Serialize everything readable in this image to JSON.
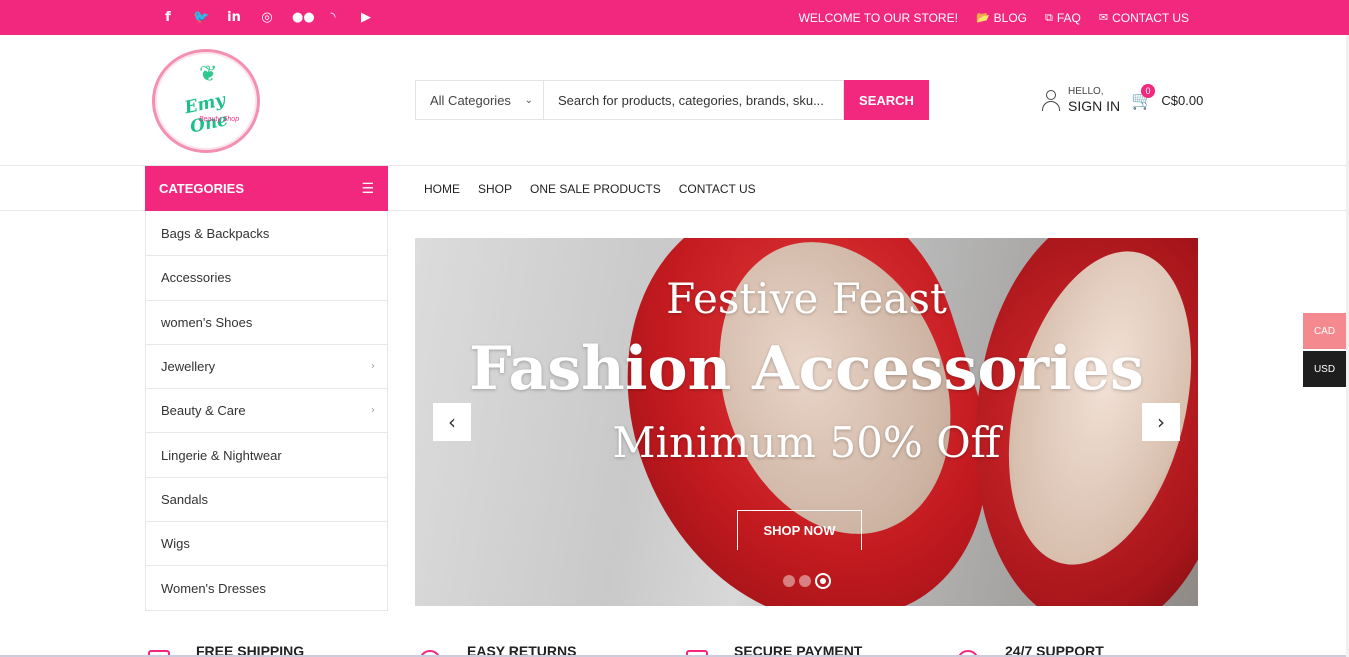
{
  "topbar": {
    "social_icons": [
      {
        "name": "facebook-icon",
        "glyph": "f"
      },
      {
        "name": "twitter-icon",
        "glyph": "🐦"
      },
      {
        "name": "linkedin-icon",
        "glyph": "in"
      },
      {
        "name": "instagram-icon",
        "glyph": "◎"
      },
      {
        "name": "flickr-icon",
        "glyph": "●●"
      },
      {
        "name": "rss-icon",
        "glyph": "◝"
      },
      {
        "name": "youtube-icon",
        "glyph": "▶"
      }
    ],
    "welcome": "WELCOME TO OUR STORE!",
    "blog": "BLOG",
    "faq": "FAQ",
    "contact": "CONTACT US",
    "blog_icon": "📂",
    "faq_icon": "⧉",
    "contact_icon": "✉"
  },
  "logo": {
    "brand": "Emy One",
    "sub": "Beauty Shop"
  },
  "search": {
    "category": "All Categories",
    "placeholder": "Search for products, categories, brands, sku...",
    "button": "SEARCH"
  },
  "account": {
    "hello": "HELLO,",
    "signin": "SIGN IN"
  },
  "cart": {
    "count": "0",
    "amount": "C$0.00"
  },
  "categories_header": "CATEGORIES",
  "mainnav": [
    "HOME",
    "SHOP",
    "ONE SALE PRODUCTS",
    "CONTACT US"
  ],
  "categories": [
    {
      "label": "Bags & Backpacks",
      "sub": false
    },
    {
      "label": "Accessories",
      "sub": false
    },
    {
      "label": "women's Shoes",
      "sub": false
    },
    {
      "label": "Jewellery",
      "sub": true
    },
    {
      "label": "Beauty & Care",
      "sub": true
    },
    {
      "label": "Lingerie & Nightwear",
      "sub": false
    },
    {
      "label": "Sandals",
      "sub": false
    },
    {
      "label": "Wigs",
      "sub": false
    },
    {
      "label": "Women's Dresses",
      "sub": false
    }
  ],
  "slider": {
    "line1": "Festive Feast",
    "line2": "Fashion Accessories",
    "line3": "Minimum 50% Off",
    "button": "SHOP NOW",
    "slide_count": 3,
    "active_slide": 3
  },
  "currency": {
    "cad": "CAD",
    "usd": "USD"
  },
  "features": [
    "FREE SHIPPING",
    "EASY RETURNS",
    "SECURE PAYMENT",
    "24/7 SUPPORT"
  ],
  "colors": {
    "accent": "#f2287f",
    "cad_bg": "#f48a8f",
    "usd_bg": "#1e1e1e"
  }
}
